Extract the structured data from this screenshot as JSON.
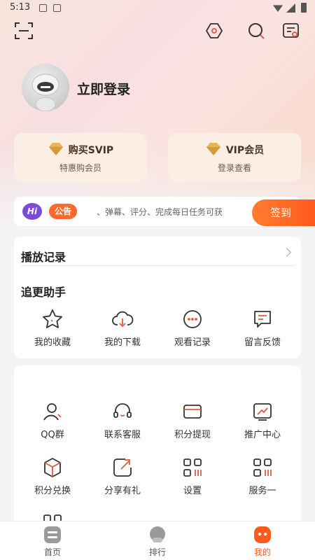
{
  "status_bar": {
    "time": "5:13"
  },
  "profile": {
    "login_text": "立即登录"
  },
  "vip_cards": [
    {
      "title": "购买SVIP",
      "subtitle": "特惠购会员"
    },
    {
      "title": "VIP会员",
      "subtitle": "登录查看"
    }
  ],
  "notice": {
    "badge": "Hi",
    "tag": "公告",
    "text": "、弹幕、评分、完成每日任务可获",
    "signin_label": "签到"
  },
  "history": {
    "title": "播放记录"
  },
  "assistant": {
    "title": "追更助手",
    "items": [
      {
        "label": "我的收藏",
        "icon": "star-icon"
      },
      {
        "label": "我的下载",
        "icon": "cloud-download-icon"
      },
      {
        "label": "观看记录",
        "icon": "chat-dots-icon"
      },
      {
        "label": "留言反馈",
        "icon": "feedback-icon"
      }
    ]
  },
  "services": {
    "items": [
      {
        "label": "QQ群",
        "icon": "user-icon"
      },
      {
        "label": "联系客服",
        "icon": "headset-icon"
      },
      {
        "label": "积分提现",
        "icon": "card-icon"
      },
      {
        "label": "推广中心",
        "icon": "trend-icon"
      },
      {
        "label": "积分兑换",
        "icon": "cube-icon"
      },
      {
        "label": "分享有礼",
        "icon": "share-icon"
      },
      {
        "label": "设置",
        "icon": "grid-icon"
      },
      {
        "label": "服务一",
        "icon": "grid-icon"
      }
    ]
  },
  "bottom_nav": [
    {
      "label": "首页",
      "icon": "home-icon",
      "active": false
    },
    {
      "label": "排行",
      "icon": "rank-icon",
      "active": false
    },
    {
      "label": "我的",
      "icon": "mine-icon",
      "active": true
    }
  ],
  "colors": {
    "accent": "#ff5a1f",
    "icon_accent": "#e8573a",
    "card_bg": "#fbeee4",
    "hi_badge": "#7c4ad6"
  }
}
